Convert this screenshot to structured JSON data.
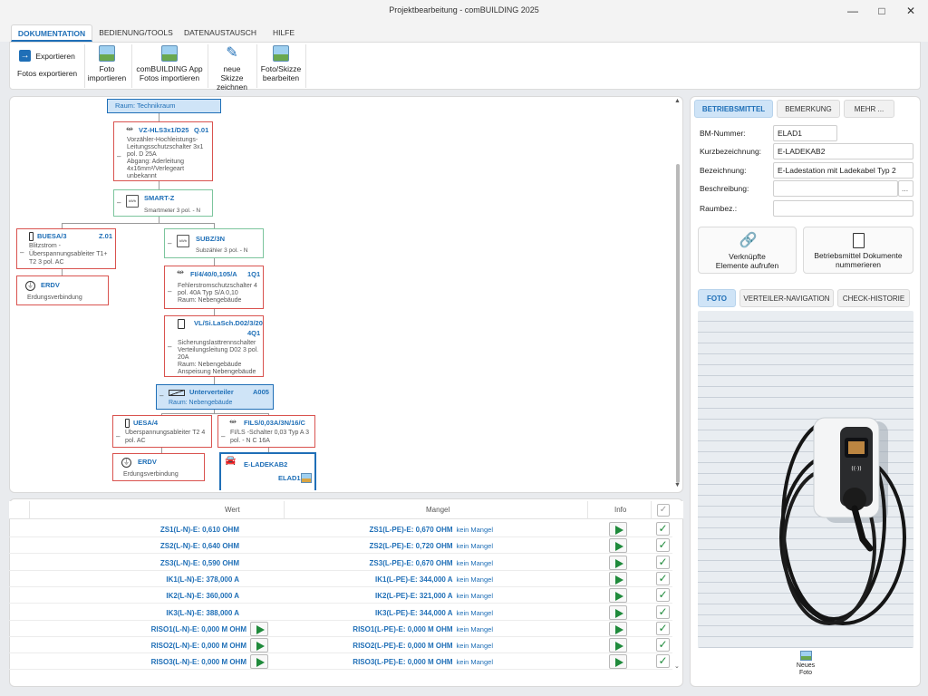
{
  "window": {
    "title": "Projektbearbeitung - comBUILDING 2025"
  },
  "ribbon_tabs": [
    "DOKUMENTATION",
    "BEDIENUNG/TOOLS",
    "DATENAUSTAUSCH",
    "HILFE"
  ],
  "ribbon": {
    "export_label": "Exportieren",
    "fotos_export_label": "Fotos exportieren",
    "foto_import_label1": "Foto",
    "foto_import_label2": "importieren",
    "app_fotos_label1": "comBUILDING App",
    "app_fotos_label2": "Fotos importieren",
    "skizze_label1": "neue Skizze",
    "skizze_label2": "zeichnen",
    "foto_skizze_label1": "Foto/Skizze",
    "foto_skizze_label2": "bearbeiten"
  },
  "tree": {
    "raum": "Raum: Technikraum",
    "vz": {
      "title": "VZ-HLS3x1/D25",
      "ref": "Q.01",
      "desc1": "Vorzähler-Hochleistungs-",
      "desc2": "Leitungsschutzschalter 3x1",
      "desc3": "pol. D 25A",
      "desc4": "Abgang: Aderleitung",
      "desc5": "4x16mm²/Verlegeart",
      "desc6": "unbekannt"
    },
    "smart": {
      "title": "SMART-Z",
      "icon": "kWh",
      "desc": "Smartmeter 3 pol. - N"
    },
    "buesa": {
      "title": "BUESA/3",
      "ref": "Z.01",
      "desc1": "Blitzstrom -",
      "desc2": "Überspannungsableiter T1+",
      "desc3": "T2 3 pol. AC"
    },
    "erdv1": {
      "title": "ERDV",
      "desc": "Erdungsverbindung"
    },
    "subz": {
      "title": "SUBZ/3N",
      "icon": "kWh",
      "desc": "Subzähler 3 pol. - N"
    },
    "fi": {
      "title": "FI/4/40/0,105/A",
      "ref": "1Q1",
      "desc1": "Fehlerstromschutzschalter 4",
      "desc2": "pol. 40A Typ S/A 0,10",
      "desc3": "Raum: Nebengebäude"
    },
    "vl": {
      "title": "VL/Si.LaSch.D02/3/20",
      "ref": "4Q1",
      "desc1": "Sicherungslasttrennschalter",
      "desc2": "Verteilungsleitung D02 3 pol.",
      "desc3": "20A",
      "desc4": "Raum: Nebengebäude",
      "desc5": "Anspeisung Nebengebäude"
    },
    "uv": {
      "title": "Unterverteiler",
      "ref": "A005",
      "desc": "Raum: Nebengebäude"
    },
    "uesa": {
      "title": "UESA/4",
      "desc1": "Überspannungsableiter T2 4",
      "desc2": "pol. AC"
    },
    "erdv2": {
      "title": "ERDV",
      "desc": "Erdungsverbindung"
    },
    "fils": {
      "title": "FILS/0,03A/3N/16/C",
      "desc1": "FI/LS -Schalter 0,03 Typ A 3",
      "desc2": "pol. - N C 16A"
    },
    "elade": {
      "title": "E-LADEKAB2",
      "ref": "ELAD1"
    }
  },
  "table": {
    "headers": {
      "wert": "Wert",
      "mangel": "Mangel",
      "info": "Info"
    },
    "rows": [
      {
        "wert": "ZS1(L-N)-E: 0,610 OHM",
        "mangel": "ZS1(L-PE)-E: 0,670 OHM",
        "status": "kein Mangel"
      },
      {
        "wert": "ZS2(L-N)-E: 0,640 OHM",
        "mangel": "ZS2(L-PE)-E: 0,720 OHM",
        "status": "kein Mangel"
      },
      {
        "wert": "ZS3(L-N)-E: 0,590 OHM",
        "mangel": "ZS3(L-PE)-E: 0,670 OHM",
        "status": "kein Mangel"
      },
      {
        "wert": "IK1(L-N)-E: 378,000 A",
        "mangel": "IK1(L-PE)-E: 344,000 A",
        "status": "kein Mangel"
      },
      {
        "wert": "IK2(L-N)-E: 360,000 A",
        "mangel": "IK2(L-PE)-E: 321,000 A",
        "status": "kein Mangel"
      },
      {
        "wert": "IK3(L-N)-E: 388,000 A",
        "mangel": "IK3(L-PE)-E: 344,000 A",
        "status": "kein Mangel"
      },
      {
        "wert": "RISO1(L-N)-E: 0,000 M OHM",
        "mangel": "RISO1(L-PE)-E: 0,000 M OHM",
        "status": "kein Mangel"
      },
      {
        "wert": "RISO2(L-N)-E: 0,000 M OHM",
        "mangel": "RISO2(L-PE)-E: 0,000 M OHM",
        "status": "kein Mangel"
      },
      {
        "wert": "RISO3(L-N)-E: 0,000 M OHM",
        "mangel": "RISO3(L-PE)-E: 0,000 M OHM",
        "status": "kein Mangel"
      }
    ]
  },
  "right": {
    "tabs": [
      "BETRIEBSMITTEL",
      "BEMERKUNG",
      "MEHR ..."
    ],
    "fields": {
      "bm_label": "BM-Nummer:",
      "bm_value": "ELAD1",
      "kurz_label": "Kurzbezeichnung:",
      "kurz_value": "E-LADEKAB2",
      "bez_label": "Bezeichnung:",
      "bez_value": "E-Ladestation mit Ladekabel Typ 2",
      "besch_label": "Beschreibung:",
      "besch_value": "",
      "besch_btn": "...",
      "raum_label": "Raumbez.:",
      "raum_value": ""
    },
    "btn_verknuepfte1": "Verknüpfte",
    "btn_verknuepfte2": "Elemente aufrufen",
    "btn_doku1": "Betriebsmittel Dokumente",
    "btn_doku2": "nummerieren",
    "photo_tabs": [
      "FOTO",
      "VERTEILER-NAVIGATION",
      "CHECK-HISTORIE"
    ],
    "neues_foto1": "Neues",
    "neues_foto2": "Foto"
  }
}
